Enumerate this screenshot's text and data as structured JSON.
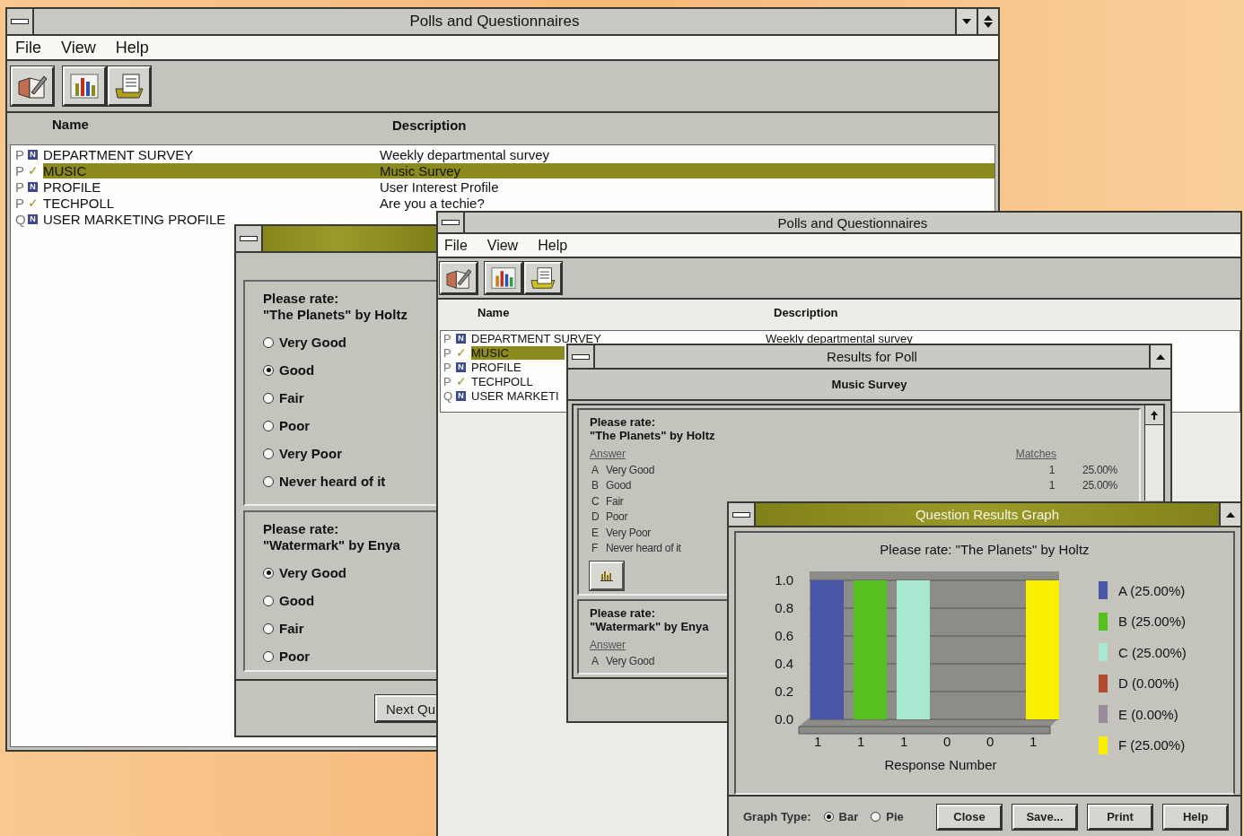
{
  "main_window": {
    "title": "Polls and Questionnaires",
    "menu": [
      "File",
      "View",
      "Help"
    ],
    "columns": [
      "Name",
      "Description"
    ],
    "rows": [
      {
        "type": "P",
        "mark": "N",
        "kind": "box",
        "name": "DEPARTMENT SURVEY",
        "description": "Weekly departmental survey",
        "selected": false
      },
      {
        "type": "P",
        "mark": "✓",
        "kind": "check",
        "name": "MUSIC",
        "description": "Music Survey",
        "selected": true
      },
      {
        "type": "P",
        "mark": "N",
        "kind": "box",
        "name": "PROFILE",
        "description": "User Interest Profile",
        "selected": false
      },
      {
        "type": "P",
        "mark": "✓",
        "kind": "check",
        "name": "TECHPOLL",
        "description": "Are you a techie?",
        "selected": false
      },
      {
        "type": "Q",
        "mark": "N",
        "kind": "box",
        "name": "USER MARKETING PROFILE",
        "selected": false
      }
    ]
  },
  "questionnaire_dialog": {
    "questions": [
      {
        "lines": [
          "Please rate:",
          "\"The Planets\" by Holtz"
        ],
        "options": [
          {
            "label": "Very Good",
            "selected": false
          },
          {
            "label": "Good",
            "selected": true
          },
          {
            "label": "Fair",
            "selected": false
          },
          {
            "label": "Poor",
            "selected": false
          },
          {
            "label": "Very Poor",
            "selected": false
          },
          {
            "label": "Never heard of it",
            "selected": false
          }
        ]
      },
      {
        "lines": [
          "Please rate:",
          "\"Watermark\" by Enya"
        ],
        "options": [
          {
            "label": "Very Good",
            "selected": true
          },
          {
            "label": "Good",
            "selected": false
          },
          {
            "label": "Fair",
            "selected": false
          },
          {
            "label": "Poor",
            "selected": false
          }
        ]
      }
    ],
    "button": "Next Qu"
  },
  "second_window": {
    "title": "Polls and Questionnaires",
    "menu": [
      "File",
      "View",
      "Help"
    ],
    "columns": [
      "Name",
      "Description"
    ],
    "rows": [
      {
        "type": "P",
        "mark": "N",
        "kind": "box",
        "name": "DEPARTMENT SURVEY",
        "description": "Weekly departmental survey",
        "selected": false
      },
      {
        "type": "P",
        "mark": "✓",
        "kind": "check",
        "name": "MUSIC",
        "selected": true
      },
      {
        "type": "P",
        "mark": "N",
        "kind": "box",
        "name": "PROFILE",
        "selected": false
      },
      {
        "type": "P",
        "mark": "✓",
        "kind": "check",
        "name": "TECHPOLL",
        "selected": false
      },
      {
        "type": "Q",
        "mark": "N",
        "kind": "box",
        "name": "USER MARKETI",
        "selected": false
      }
    ]
  },
  "results_window": {
    "title": "Results for Poll",
    "subtitle": "Music Survey",
    "questions": [
      {
        "lines": [
          "Please rate:",
          "\"The Planets\" by Holtz"
        ],
        "answer_header": "Answer",
        "matches_header": "Matches",
        "graph_button": true,
        "answers": [
          {
            "letter": "A",
            "label": "Very Good",
            "matches": "1",
            "percent": "25.00%"
          },
          {
            "letter": "B",
            "label": "Good",
            "matches": "1",
            "percent": "25.00%"
          },
          {
            "letter": "C",
            "label": "Fair"
          },
          {
            "letter": "D",
            "label": "Poor"
          },
          {
            "letter": "E",
            "label": "Very Poor"
          },
          {
            "letter": "F",
            "label": "Never heard of it"
          }
        ]
      },
      {
        "lines": [
          "Please rate:",
          "\"Watermark\" by Enya"
        ],
        "answer_header": "Answer",
        "graph_button": false,
        "answers": [
          {
            "letter": "A",
            "label": "Very Good"
          }
        ]
      }
    ]
  },
  "graph_window": {
    "title": "Question Results Graph",
    "chart_data": {
      "type": "bar",
      "title": "Please rate:  \"The Planets\" by Holtz",
      "xlabel": "Response Number",
      "categories": [
        "1",
        "1",
        "1",
        "0",
        "0",
        "1"
      ],
      "series": [
        {
          "values": [
            1,
            1,
            1,
            0,
            0,
            1
          ]
        }
      ],
      "ylim": [
        0,
        1
      ],
      "grid": true,
      "yticks": [
        {
          "value": 0,
          "label": "0.0"
        },
        {
          "value": 0.2,
          "label": "0.2"
        },
        {
          "value": 0.4,
          "label": "0.4"
        },
        {
          "value": 0.6,
          "label": "0.6"
        },
        {
          "value": 0.8,
          "label": "0.8"
        },
        {
          "value": 1,
          "label": "1.0"
        }
      ]
    },
    "legend": [
      {
        "label": "A (25.00%)",
        "color": "#4a56a8"
      },
      {
        "label": "B (25.00%)",
        "color": "#55c020"
      },
      {
        "label": "C (25.00%)",
        "color": "#a8e8d0"
      },
      {
        "label": "D (0.00%)",
        "color": "#b04a30"
      },
      {
        "label": "E (0.00%)",
        "color": "#9a8a9a"
      },
      {
        "label": "F (25.00%)",
        "color": "#f8f000"
      }
    ],
    "graph_type_label": "Graph Type:",
    "graph_types": [
      {
        "label": "Bar",
        "selected": true
      },
      {
        "label": "Pie",
        "selected": false
      }
    ],
    "buttons": [
      "Close",
      "Save...",
      "Print",
      "Help"
    ]
  }
}
